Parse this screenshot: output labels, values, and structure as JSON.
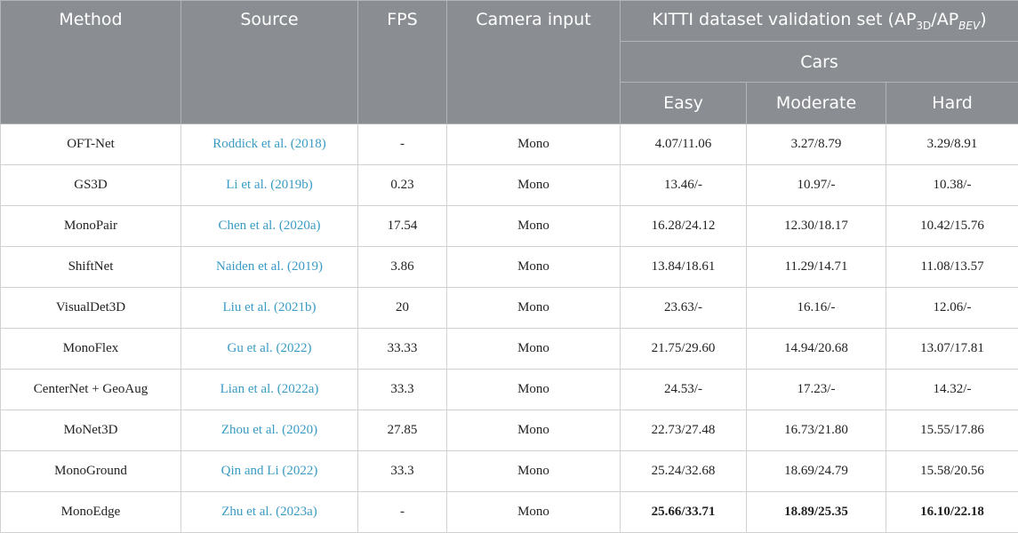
{
  "header": {
    "method": "Method",
    "source": "Source",
    "fps": "FPS",
    "camera_input": "Camera input",
    "kitti_prefix": "KITTI dataset validation set (AP",
    "kitti_sub1": "3D",
    "kitti_mid": "/AP",
    "kitti_sub2": "BEV",
    "kitti_suffix": ")",
    "cars": "Cars",
    "easy": "Easy",
    "moderate": "Moderate",
    "hard": "Hard"
  },
  "rows": [
    {
      "method": "OFT-Net",
      "source": "Roddick et al. (2018)",
      "fps": "-",
      "camera": "Mono",
      "easy": "4.07/11.06",
      "moderate": "3.27/8.79",
      "hard": "3.29/8.91"
    },
    {
      "method": "GS3D",
      "source": "Li et al. (2019b)",
      "fps": "0.23",
      "camera": "Mono",
      "easy": "13.46/-",
      "moderate": "10.97/-",
      "hard": "10.38/-"
    },
    {
      "method": "MonoPair",
      "source": "Chen et al. (2020a)",
      "fps": "17.54",
      "camera": "Mono",
      "easy": "16.28/24.12",
      "moderate": "12.30/18.17",
      "hard": "10.42/15.76"
    },
    {
      "method": "ShiftNet",
      "source": "Naiden et al. (2019)",
      "fps": "3.86",
      "camera": "Mono",
      "easy": "13.84/18.61",
      "moderate": "11.29/14.71",
      "hard": "11.08/13.57"
    },
    {
      "method": "VisualDet3D",
      "source": "Liu et al. (2021b)",
      "fps": "20",
      "camera": "Mono",
      "easy": "23.63/-",
      "moderate": "16.16/-",
      "hard": "12.06/-"
    },
    {
      "method": "MonoFlex",
      "source": "Gu et al. (2022)",
      "fps": "33.33",
      "camera": "Mono",
      "easy": "21.75/29.60",
      "moderate": "14.94/20.68",
      "hard": "13.07/17.81"
    },
    {
      "method": "CenterNet + GeoAug",
      "source": "Lian et al. (2022a)",
      "fps": "33.3",
      "camera": "Mono",
      "easy": "24.53/-",
      "moderate": "17.23/-",
      "hard": "14.32/-"
    },
    {
      "method": "MoNet3D",
      "source": "Zhou et al. (2020)",
      "fps": "27.85",
      "camera": "Mono",
      "easy": "22.73/27.48",
      "moderate": "16.73/21.80",
      "hard": "15.55/17.86"
    },
    {
      "method": "MonoGround",
      "source": "Qin and Li (2022)",
      "fps": "33.3",
      "camera": "Mono",
      "easy": "25.24/32.68",
      "moderate": "18.69/24.79",
      "hard": "15.58/20.56"
    },
    {
      "method": "MonoEdge",
      "source": "Zhu et al. (2023a)",
      "fps": "-",
      "camera": "Mono",
      "easy": "25.66/33.71",
      "moderate": "18.89/25.35",
      "hard": "16.10/22.18"
    }
  ],
  "colors": {
    "header_bg": "#8a8e92",
    "header_text": "#ffffff",
    "link": "#3a9bc4"
  }
}
